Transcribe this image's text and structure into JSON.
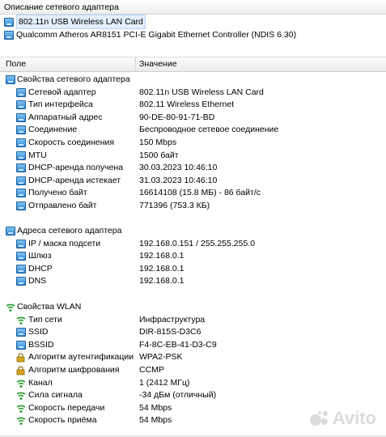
{
  "header": {
    "title": "Описание сетевого адаптера"
  },
  "adapters": [
    {
      "name": "802.11n USB Wireless LAN Card",
      "selected": true
    },
    {
      "name": "Qualcomm Atheros AR8151 PCI-E Gigabit Ethernet Controller (NDIS 6.30)",
      "selected": false
    }
  ],
  "columns": {
    "field": "Поле",
    "value": "Значение"
  },
  "sections": {
    "adapter_props": {
      "title": "Свойства сетевого адаптера",
      "rows": [
        {
          "label": "Сетевой адаптер",
          "value": "802.11n USB Wireless LAN Card"
        },
        {
          "label": "Тип интерфейса",
          "value": "802.11 Wireless Ethernet"
        },
        {
          "label": "Аппаратный адрес",
          "value": "90-DE-80-91-71-BD"
        },
        {
          "label": "Соединение",
          "value": "Беспроводное сетевое соединение"
        },
        {
          "label": "Скорость соединения",
          "value": "150 Mbps"
        },
        {
          "label": "MTU",
          "value": "1500 байт"
        },
        {
          "label": "DHCP-аренда получена",
          "value": "30.03.2023 10:46:10"
        },
        {
          "label": "DHCP-аренда истекает",
          "value": "31.03.2023 10:46:10"
        },
        {
          "label": "Получено байт",
          "value": "16614108 (15.8 МБ) - 86 байт/с"
        },
        {
          "label": "Отправлено байт",
          "value": "771396 (753.3 КБ)"
        }
      ]
    },
    "addresses": {
      "title": "Адреса сетевого адаптера",
      "rows": [
        {
          "label": "IP / маска подсети",
          "value": "192.168.0.151 / 255.255.255.0"
        },
        {
          "label": "Шлюз",
          "value": "192.168.0.1"
        },
        {
          "label": "DHCP",
          "value": "192.168.0.1"
        },
        {
          "label": "DNS",
          "value": "192.168.0.1"
        }
      ]
    },
    "wlan": {
      "title": "Свойства WLAN",
      "rows": [
        {
          "label": "Тип сети",
          "value": "Инфраструктура"
        },
        {
          "label": "SSID",
          "value": "DIR-815S-D3C6"
        },
        {
          "label": "BSSID",
          "value": "F4-8C-EB-41-D3-C9"
        },
        {
          "label": "Алгоритм аутентификации",
          "value": "WPA2-PSK"
        },
        {
          "label": "Алгоритм шифрования",
          "value": "CCMP"
        },
        {
          "label": "Канал",
          "value": "1 (2412 МГц)"
        },
        {
          "label": "Сила сигнала",
          "value": "-34 дБм (отличный)"
        },
        {
          "label": "Скорость передачи",
          "value": "54 Mbps"
        },
        {
          "label": "Скорость приёма",
          "value": "54 Mbps"
        }
      ]
    }
  },
  "watermark": {
    "text": "Avito"
  },
  "colors": {
    "selection": "#e3effc",
    "icon_blue": "#2f86cf",
    "wifi_green": "#2e9b2e",
    "shield_gold": "#d9a51c"
  }
}
